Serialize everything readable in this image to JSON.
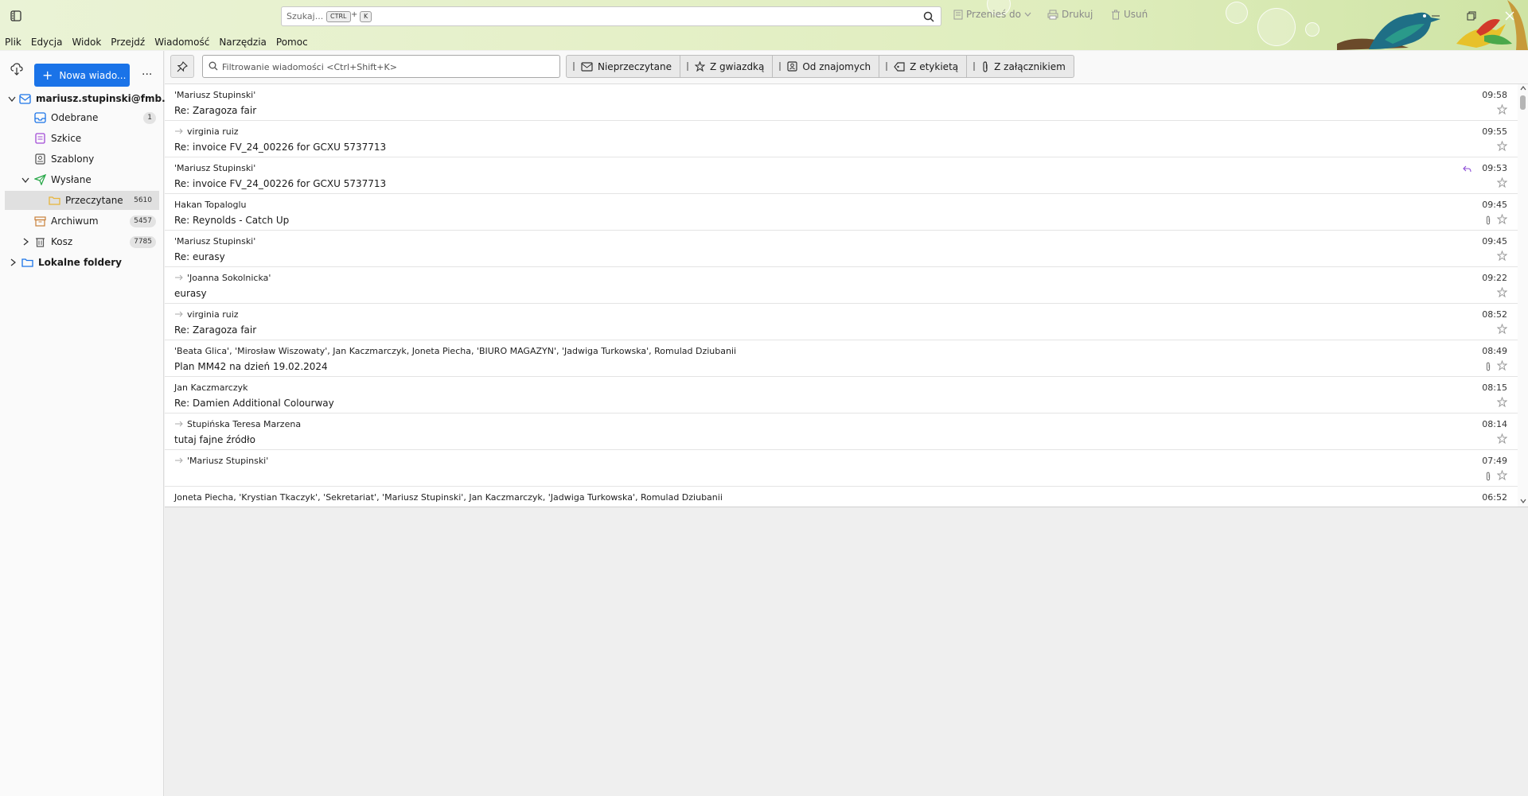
{
  "titlebar": {
    "search_placeholder": "Szukaj...",
    "kbd_ctrl": "CTRL",
    "kbd_plus": "+",
    "kbd_k": "K",
    "move_label": "Przenieś do",
    "print_label": "Drukuj",
    "delete_label": "Usuń"
  },
  "menubar": {
    "items": [
      "Plik",
      "Edycja",
      "Widok",
      "Przejdź",
      "Wiadomość",
      "Narzędzia",
      "Pomoc"
    ]
  },
  "sidebar": {
    "new_message_label": "Nowa wiado...",
    "more_label": "···",
    "account": "mariusz.stupinski@fmb...",
    "folders": [
      {
        "label": "Odebrane",
        "badge": "1"
      },
      {
        "label": "Szkice",
        "badge": ""
      },
      {
        "label": "Szablony",
        "badge": ""
      },
      {
        "label": "Wysłane",
        "badge": ""
      },
      {
        "label": "Przeczytane",
        "badge": "5610"
      },
      {
        "label": "Archiwum",
        "badge": "5457"
      },
      {
        "label": "Kosz",
        "badge": "7785"
      }
    ],
    "local_folders": "Lokalne foldery"
  },
  "filterbar": {
    "placeholder": "Filtrowanie wiadomości <Ctrl+Shift+K>",
    "quick_filters": [
      "Nieprzeczytane",
      "Z gwiazdką",
      "Od znajomych",
      "Z etykietą",
      "Z załącznikiem"
    ]
  },
  "messages": [
    {
      "from": "'Mariusz Stupinski'",
      "subject": "Re: Zaragoza fair",
      "time": "09:58",
      "forwarded": false,
      "attachment": false,
      "replied": false
    },
    {
      "from": "virginia ruiz",
      "subject": "Re: invoice FV_24_00226 for GCXU 5737713",
      "time": "09:55",
      "forwarded": true,
      "attachment": false,
      "replied": false
    },
    {
      "from": "'Mariusz Stupinski'",
      "subject": "Re: invoice FV_24_00226 for GCXU 5737713",
      "time": "09:53",
      "forwarded": false,
      "attachment": false,
      "replied": true
    },
    {
      "from": "Hakan Topaloglu",
      "subject": "Re: Reynolds - Catch Up",
      "time": "09:45",
      "forwarded": false,
      "attachment": true,
      "replied": false
    },
    {
      "from": "'Mariusz Stupinski'",
      "subject": "Re: eurasy",
      "time": "09:45",
      "forwarded": false,
      "attachment": false,
      "replied": false
    },
    {
      "from": "'Joanna Sokolnicka'",
      "subject": "eurasy",
      "time": "09:22",
      "forwarded": true,
      "attachment": false,
      "replied": false
    },
    {
      "from": "virginia ruiz",
      "subject": "Re: Zaragoza fair",
      "time": "08:52",
      "forwarded": true,
      "attachment": false,
      "replied": false
    },
    {
      "from": "'Beata Glica', 'Mirosław Wiszowaty', Jan Kaczmarczyk, Joneta Piecha, 'BIURO MAGAZYN', 'Jadwiga Turkowska', Romulad Dziubanii",
      "subject": "Plan MM42 na dzień 19.02.2024",
      "time": "08:49",
      "forwarded": false,
      "attachment": true,
      "replied": false
    },
    {
      "from": "Jan Kaczmarczyk",
      "subject": "Re: Damien Additional Colourway",
      "time": "08:15",
      "forwarded": false,
      "attachment": false,
      "replied": false
    },
    {
      "from": "Stupińska Teresa Marzena",
      "subject": "tutaj fajne źródło",
      "time": "08:14",
      "forwarded": true,
      "attachment": false,
      "replied": false
    },
    {
      "from": "'Mariusz Stupinski'",
      "subject": "",
      "time": "07:49",
      "forwarded": true,
      "attachment": true,
      "replied": false
    },
    {
      "from": "Joneta Piecha, 'Krystian Tkaczyk', 'Sekretariat', 'Mariusz Stupinski', Jan Kaczmarczyk, 'Jadwiga Turkowska', Romulad Dziubanii",
      "subject": "",
      "time": "06:52",
      "forwarded": false,
      "attachment": false,
      "replied": false
    }
  ],
  "colors": {
    "accent": "#1a73e8",
    "folder_yellow": "#e8b53a",
    "sent_green": "#2aa84a"
  }
}
